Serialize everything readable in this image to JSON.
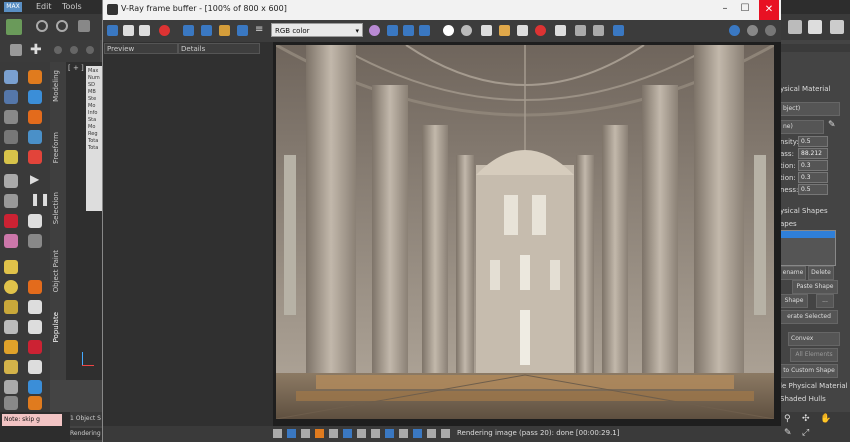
{
  "max": {
    "logo": "MAX",
    "menu": [
      "Edit",
      "Tools"
    ],
    "left_tabs": [
      "Modeling",
      "Freeform",
      "Selection",
      "Object Paint",
      "Populate"
    ],
    "viewport_label": "[ + ]",
    "scene_list": [
      "Max",
      "Num",
      "SD",
      "MB",
      "Ste",
      "Mo",
      "Info",
      "Sta",
      "Mo",
      "Reg",
      "Tota",
      "Tota"
    ],
    "note_text": "Note: skip g",
    "object_selected": "1 Object S",
    "rendering_label": "Rendering",
    "right_panel": {
      "header": "ysical Material",
      "dropdown1": "bject)",
      "dropdown2": "ne)",
      "params": [
        {
          "label": "nsity:",
          "value": "0.5"
        },
        {
          "label": "ass:",
          "value": "88.212"
        },
        {
          "label": "tion:",
          "value": "0.3"
        },
        {
          "label": "tion:",
          "value": "0.3"
        },
        {
          "label": "ness:",
          "value": "0.5"
        }
      ],
      "shapes_header": "ysical Shapes",
      "shapes_label": "apes",
      "rename": "ename",
      "delete": "Delete",
      "paste_shape": "Paste Shape",
      "shape": "Shape",
      "ellipsis": "...",
      "generate": "erate Selected",
      "convex": "Convex",
      "all_elements": "All Elements",
      "custom_shape": "to Custom Shape",
      "physical_material": "le Physical Material",
      "shaded_hulls": "Shaded Hulls"
    }
  },
  "vfb": {
    "title": "V-Ray frame buffer - [100% of 800 x 600]",
    "channel": "RGB color",
    "history_cols": [
      "Preview",
      "Details"
    ],
    "status": "Rendering image (pass 20): done [00:00:29.1]"
  },
  "colors": {
    "toolbar_blue": "#3a78c2",
    "close_red": "#e81123",
    "note_pink": "#f2c4c4",
    "selection_blue": "#2f7fd8"
  }
}
